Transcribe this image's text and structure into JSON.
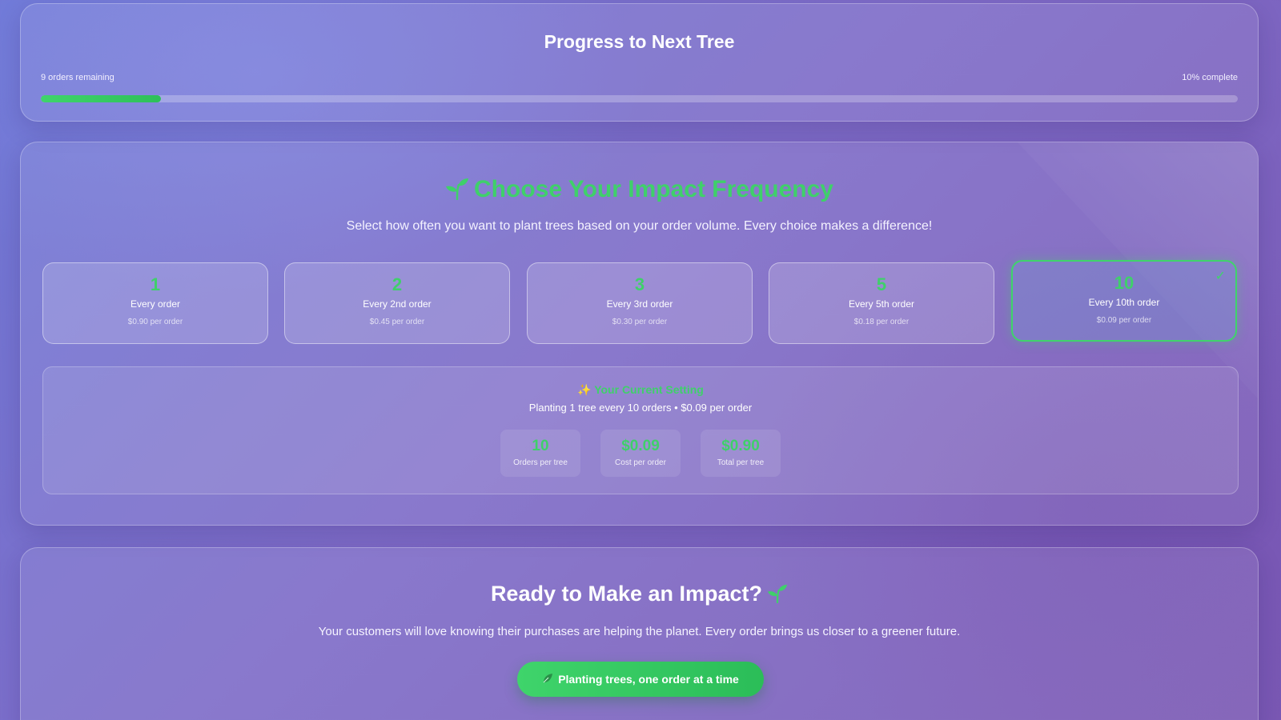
{
  "progress": {
    "title": "Progress to Next Tree",
    "remaining_text": "9 orders remaining",
    "complete_text": "10% complete",
    "percent": 10
  },
  "impact": {
    "title": "Choose Your Impact Frequency",
    "subtitle": "Select how often you want to plant trees based on your order volume. Every choice makes a difference!",
    "options": [
      {
        "num": "1",
        "label": "Every order",
        "price": "$0.90 per order",
        "selected": false
      },
      {
        "num": "2",
        "label": "Every 2nd order",
        "price": "$0.45 per order",
        "selected": false
      },
      {
        "num": "3",
        "label": "Every 3rd order",
        "price": "$0.30 per order",
        "selected": false
      },
      {
        "num": "5",
        "label": "Every 5th order",
        "price": "$0.18 per order",
        "selected": false
      },
      {
        "num": "10",
        "label": "Every 10th order",
        "price": "$0.09 per order",
        "selected": true
      }
    ],
    "check_glyph": "✓"
  },
  "current": {
    "title": "✨ Your Current Setting",
    "description": "Planting 1 tree every 10 orders • $0.09 per order",
    "stats": [
      {
        "value": "10",
        "name": "Orders per tree"
      },
      {
        "value": "$0.09",
        "name": "Cost per order"
      },
      {
        "value": "$0.90",
        "name": "Total per tree"
      }
    ]
  },
  "cta": {
    "title": "Ready to Make an Impact?",
    "subtitle": "Your customers will love knowing their purchases are helping the planet. Every order brings us closer to a greener future.",
    "button_label": "Planting trees, one order at a time"
  },
  "colors": {
    "accent_green": "#3fd06a",
    "background_start": "#6e78d6",
    "background_end": "#7a58b4"
  },
  "icons": {
    "title_icon": "sprout-icon",
    "cta_icon": "sprout-icon",
    "button_icon": "leaf-icon"
  }
}
